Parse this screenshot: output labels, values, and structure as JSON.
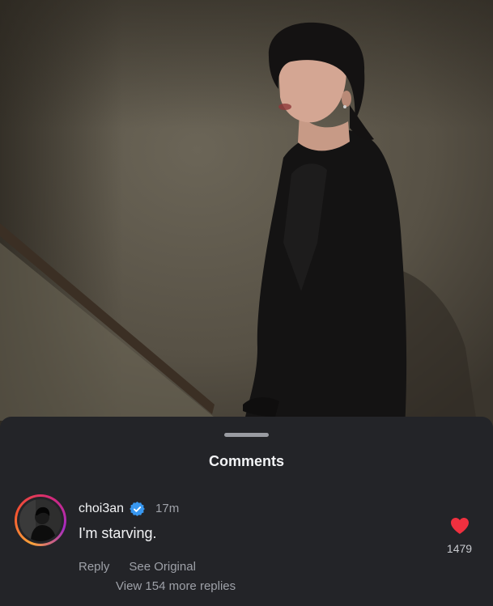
{
  "sheet": {
    "title": "Comments"
  },
  "comment": {
    "username": "choi3an",
    "verified_icon": "verified-badge-icon",
    "time": "17m",
    "text": "I'm starving.",
    "reply_label": "Reply",
    "see_original_label": "See Original",
    "like_icon": "heart-icon",
    "like_count": "1479",
    "liked": true,
    "view_replies_label": "View 154 more replies"
  },
  "colors": {
    "heart": "#f0303f",
    "verified": "#3897f0",
    "sheet_background": "#232428"
  }
}
